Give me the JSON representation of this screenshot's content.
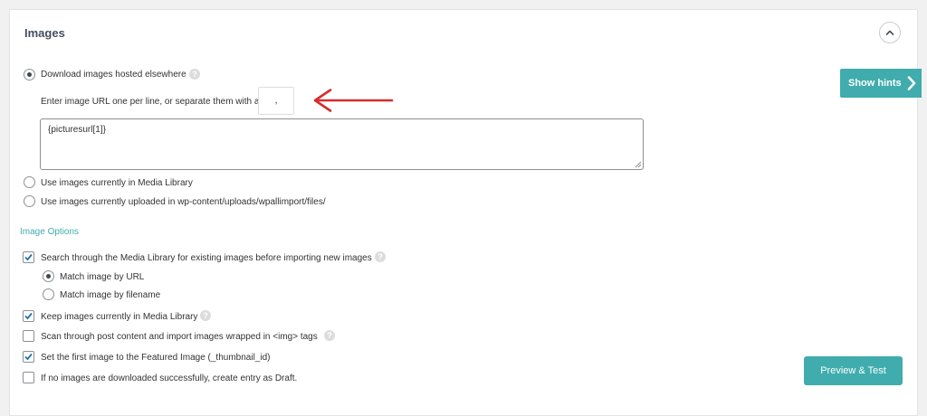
{
  "section": {
    "title": "Images",
    "collapse_icon": "chevron-up-icon"
  },
  "hints_button": {
    "label": "Show hints",
    "icon": "chevron-right-icon"
  },
  "source_options": [
    {
      "label": "Download images hosted elsewhere",
      "selected": true,
      "help": "?"
    },
    {
      "label": "Use images currently in Media Library",
      "selected": false
    },
    {
      "label": "Use images currently uploaded in wp-content/uploads/wpallimport/files/",
      "selected": false
    }
  ],
  "url_input": {
    "instruction": "Enter image URL one per line, or separate them with a",
    "separator_value": ",",
    "textarea_value": "{picturesurl[1]}"
  },
  "image_options": {
    "heading": "Image Options",
    "items": [
      {
        "label": "Search through the Media Library for existing images before importing new images",
        "checked": true,
        "help": "?"
      },
      {
        "label": "Match image by URL",
        "selected": true
      },
      {
        "label": "Match image by filename",
        "selected": false
      },
      {
        "label": "Keep images currently in Media Library",
        "checked": true,
        "help": "?"
      },
      {
        "label": "Scan through post content and import images wrapped in <img> tags",
        "checked": false,
        "help": "?"
      },
      {
        "label": "Set the first image to the Featured Image (_thumbnail_id)",
        "checked": true
      },
      {
        "label": "If no images are downloaded successfully, create entry as Draft.",
        "checked": false
      }
    ]
  },
  "preview_button": {
    "label": "Preview & Test"
  },
  "colors": {
    "accent": "#40acad",
    "title": "#444e61",
    "arrow": "#d62c2c"
  }
}
